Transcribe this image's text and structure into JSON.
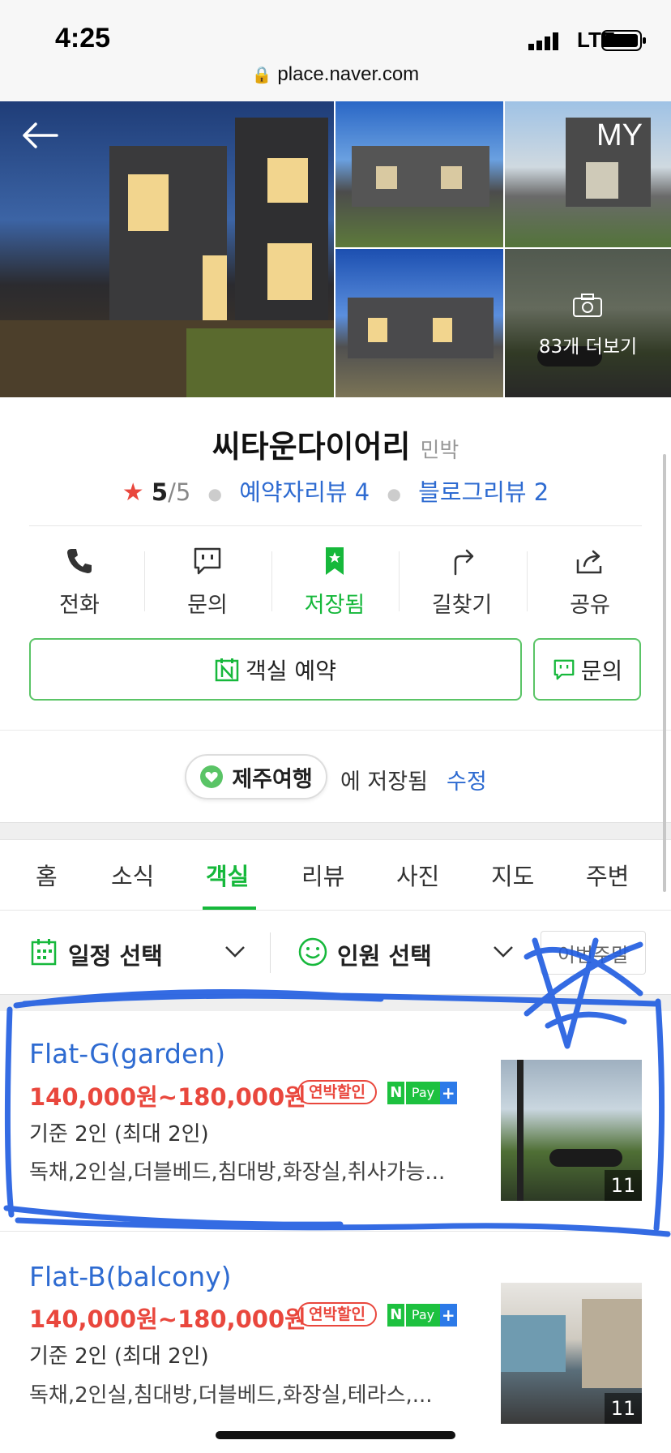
{
  "status_bar": {
    "time": "4:25",
    "carrier": "LTE",
    "url": "place.naver.com"
  },
  "header": {
    "my_label": "MY",
    "more_photos": "83개 더보기"
  },
  "place": {
    "name": "씨타운다이어리",
    "category": "민박",
    "rating": "5",
    "rating_max": "/5",
    "booking_reviews": "예약자리뷰 4",
    "blog_reviews": "블로그리뷰 2"
  },
  "actions": [
    {
      "label": "전화",
      "icon": "phone-icon"
    },
    {
      "label": "문의",
      "icon": "chat-icon"
    },
    {
      "label": "저장됨",
      "icon": "bookmark-icon"
    },
    {
      "label": "길찾기",
      "icon": "directions-icon"
    },
    {
      "label": "공유",
      "icon": "share-icon"
    }
  ],
  "buttons": {
    "book": "객실 예약",
    "inquiry": "문의"
  },
  "saved": {
    "folder": "제주여행",
    "text": "에 저장됨",
    "edit": "수정"
  },
  "tabs": [
    "홈",
    "소식",
    "객실",
    "리뷰",
    "사진",
    "지도",
    "주변"
  ],
  "active_tab": "객실",
  "filters": {
    "date": "일정 선택",
    "people": "인원 선택",
    "weekend": "이번주말"
  },
  "rooms": [
    {
      "name": "Flat-G(garden)",
      "price": "140,000원~180,000원",
      "badge": "연박할인",
      "pay": "Pay",
      "capacity": "기준 2인 (최대 2인)",
      "features": "독채,2인실,더블베드,침대방,화장실,취사가능...",
      "photo_count": "11"
    },
    {
      "name": "Flat-B(balcony)",
      "price": "140,000원~180,000원",
      "badge": "연박할인",
      "pay": "Pay",
      "capacity": "기준 2인 (최대 2인)",
      "features": "독채,2인실,침대방,더블베드,화장실,테라스,...",
      "photo_count": "11"
    }
  ],
  "colors": {
    "accent_green": "#16b83b",
    "link_blue": "#2e6bd1",
    "price_red": "#e9473d",
    "scribble_blue": "#1f5ce0"
  }
}
